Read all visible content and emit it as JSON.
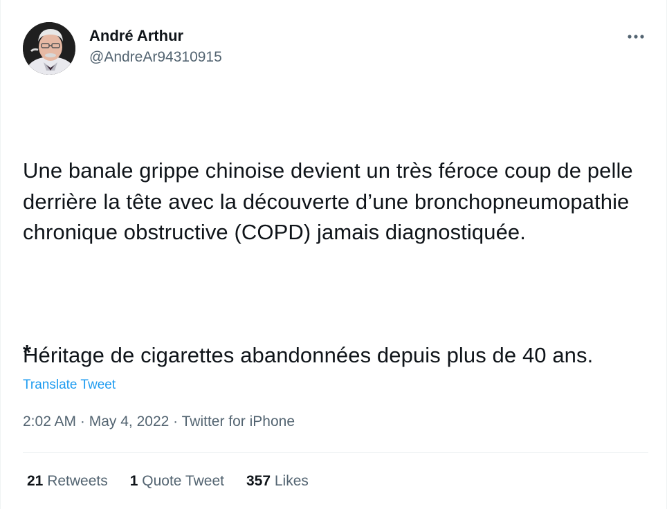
{
  "tweet": {
    "author": {
      "display_name": "André Arthur",
      "handle": "@AndreAr94310915",
      "avatar_icon": "user-avatar-photo"
    },
    "more_icon": "more-options-icon",
    "text_paragraph_1": "Une banale grippe chinoise devient un très féroce coup de pelle derrière la tête avec la découverte d’une bronchopneumopathie chronique obstructive (COPD) jamais diagnostiquée.",
    "text_paragraph_2": "Héritage de cigarettes abandonnées depuis plus de 40 ans.",
    "text_asterisk": "*",
    "translate_label": "Translate Tweet",
    "time": "2:02 AM",
    "separator": "·",
    "date": "May 4, 2022",
    "source": "Twitter for iPhone",
    "stats": {
      "retweets_count": "21",
      "retweets_label": "Retweets",
      "quotes_count": "1",
      "quotes_label": "Quote Tweet",
      "likes_count": "357",
      "likes_label": "Likes"
    },
    "colors": {
      "text": "#0f1419",
      "secondary": "#536471",
      "link": "#1d9bf0",
      "divider": "#eff3f4"
    }
  }
}
